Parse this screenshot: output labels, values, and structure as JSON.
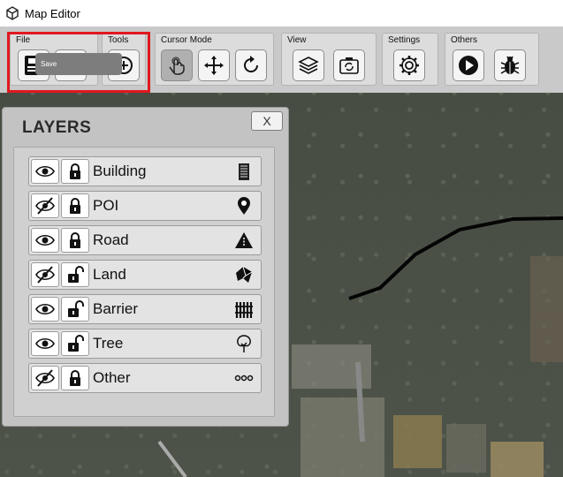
{
  "window": {
    "title": "Map Editor"
  },
  "toolbar": {
    "groups": [
      {
        "label": "File"
      },
      {
        "label": "Tools"
      },
      {
        "label": "Cursor Mode"
      },
      {
        "label": "View"
      },
      {
        "label": "Settings"
      },
      {
        "label": "Others"
      }
    ],
    "tooltip": "Save"
  },
  "layers_panel": {
    "title": "LAYERS",
    "close_label": "X",
    "layers": [
      {
        "name": "Building",
        "visible": true,
        "locked": true,
        "icon": "building-icon"
      },
      {
        "name": "POI",
        "visible": false,
        "locked": true,
        "icon": "pin-icon"
      },
      {
        "name": "Road",
        "visible": true,
        "locked": true,
        "icon": "road-sign-icon"
      },
      {
        "name": "Land",
        "visible": false,
        "locked": false,
        "icon": "land-icon"
      },
      {
        "name": "Barrier",
        "visible": true,
        "locked": false,
        "icon": "fence-icon"
      },
      {
        "name": "Tree",
        "visible": true,
        "locked": false,
        "icon": "tree-icon"
      },
      {
        "name": "Other",
        "visible": false,
        "locked": true,
        "icon": "dots-icon"
      }
    ]
  },
  "colors": {
    "highlight": "#e0181f",
    "toolbar": "#c9c9c9",
    "panel": "#c3c3c3"
  }
}
